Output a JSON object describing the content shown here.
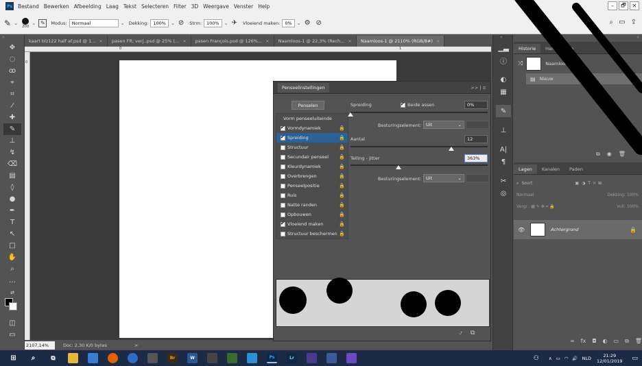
{
  "menubar": {
    "logo": "Ps",
    "items": [
      "Bestand",
      "Bewerken",
      "Afbeelding",
      "Laag",
      "Tekst",
      "Selecteren",
      "Filter",
      "3D",
      "Weergave",
      "Venster",
      "Help"
    ],
    "window_controls": [
      "–",
      "🗗",
      "✕"
    ]
  },
  "options": {
    "brush_size": "200",
    "modus_label": "Modus:",
    "modus_value": "Normaal",
    "dekking_label": "Dekking:",
    "dekking_value": "100%",
    "stroom_label": "Strm:",
    "stroom_value": "100%",
    "vloeiend_label": "Vloeiend maken:",
    "vloeiend_value": "0%"
  },
  "tabs": [
    {
      "label": "kaart blz122 half af.psd @ 1...",
      "close": "×"
    },
    {
      "label": "pasen FR; verj..psd @ 25% (...",
      "close": "×"
    },
    {
      "label": "pasen François.psd @ 126%...",
      "close": "×"
    },
    {
      "label": "Naamloos-1 @ 22,3% (Rech...",
      "close": "×"
    },
    {
      "label": "Naamloos-1 @ 2110% (RGB/8#)",
      "close": "×"
    }
  ],
  "status": {
    "zoom": "2107,14%",
    "doc": "Doc: 2,30 K/0 bytes",
    "arrow": ">"
  },
  "ruler": {
    "top_marks": [
      "0",
      "1"
    ],
    "left_mark": "0"
  },
  "brush_panel": {
    "title": "Penseelinstellingen",
    "header_icons": ">> | ≡",
    "penselen_button": "Penselen",
    "list": [
      {
        "label": "Vorm penseeluiteinde",
        "checkbox": false,
        "checked": false,
        "lock": false,
        "selected": false
      },
      {
        "label": "Vormdynamiek",
        "checkbox": true,
        "checked": true,
        "lock": true,
        "selected": false
      },
      {
        "label": "Spreiding",
        "checkbox": true,
        "checked": true,
        "lock": true,
        "selected": true
      },
      {
        "label": "Structuur",
        "checkbox": true,
        "checked": false,
        "lock": true,
        "selected": false
      },
      {
        "label": "Secundair penseel",
        "checkbox": true,
        "checked": false,
        "lock": true,
        "selected": false
      },
      {
        "label": "Kleurdynamiek",
        "checkbox": true,
        "checked": false,
        "lock": true,
        "selected": false
      },
      {
        "label": "Overbrengen",
        "checkbox": true,
        "checked": false,
        "lock": true,
        "selected": false
      },
      {
        "label": "Penseelpositie",
        "checkbox": true,
        "checked": false,
        "lock": true,
        "selected": false
      },
      {
        "label": "Ruis",
        "checkbox": true,
        "checked": false,
        "lock": true,
        "selected": false
      },
      {
        "label": "Natte randen",
        "checkbox": true,
        "checked": false,
        "lock": true,
        "selected": false
      },
      {
        "label": "Opbouwen",
        "checkbox": true,
        "checked": false,
        "lock": true,
        "selected": false
      },
      {
        "label": "Vloeiend maken",
        "checkbox": true,
        "checked": true,
        "lock": true,
        "selected": false
      },
      {
        "label": "Structuur beschermen",
        "checkbox": true,
        "checked": false,
        "lock": true,
        "selected": false
      }
    ],
    "spreiding_label": "Spreiding",
    "beide_assen_label": "Beide assen",
    "spreiding_value": "0%",
    "besturing1_label": "Besturingselement:",
    "besturing1_value": "Uit",
    "aantal_label": "Aantal",
    "aantal_value": "12",
    "telling_label": "Telling - jitter",
    "telling_value": "363%",
    "besturing2_label": "Besturingselement:",
    "besturing2_value": "Uit",
    "lock_glyph": "🔒"
  },
  "right": {
    "history_tabs": [
      "Historie",
      "Handelingen"
    ],
    "history_items": [
      "Naamloos-1",
      "Nieuw"
    ],
    "layer_tabs": [
      "Lagen",
      "Kanalen",
      "Paden"
    ],
    "search_kind": "Soort",
    "blend_mode": "Normaal",
    "opacity_label": "Dekking:",
    "opacity_value": "100%",
    "lock_label": "Vergr.:",
    "fill_label": "Vull:",
    "fill_value": "100%",
    "layer_name": "Achtergrond"
  },
  "taskbar": {
    "language": "NLD",
    "time": "21:29",
    "date": "12/01/2019"
  },
  "colors": {
    "selection_blue": "#2a6196",
    "taskbar": "#1c2b45",
    "watermark": "#000000"
  }
}
